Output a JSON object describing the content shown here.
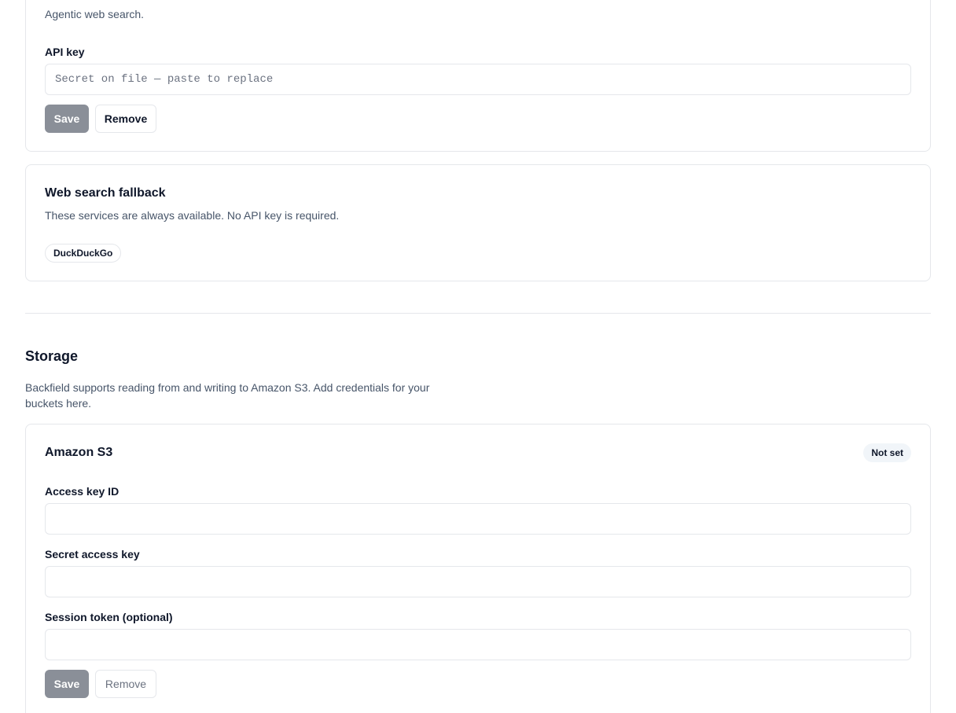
{
  "search_provider": {
    "description": "Agentic web search.",
    "api_key_label": "API key",
    "api_key_placeholder": "Secret on file — paste to replace",
    "api_key_value": "",
    "save_label": "Save",
    "remove_label": "Remove"
  },
  "fallback": {
    "title": "Web search fallback",
    "description": "These services are always available. No API key is required.",
    "services": [
      "DuckDuckGo"
    ]
  },
  "storage": {
    "title": "Storage",
    "description": "Backfield supports reading from and writing to Amazon S3. Add credentials for your buckets here.",
    "s3": {
      "title": "Amazon S3",
      "status": "Not set",
      "access_key_label": "Access key ID",
      "access_key_value": "",
      "secret_key_label": "Secret access key",
      "secret_key_value": "",
      "session_token_label": "Session token (optional)",
      "session_token_value": "",
      "save_label": "Save",
      "remove_label": "Remove"
    }
  }
}
